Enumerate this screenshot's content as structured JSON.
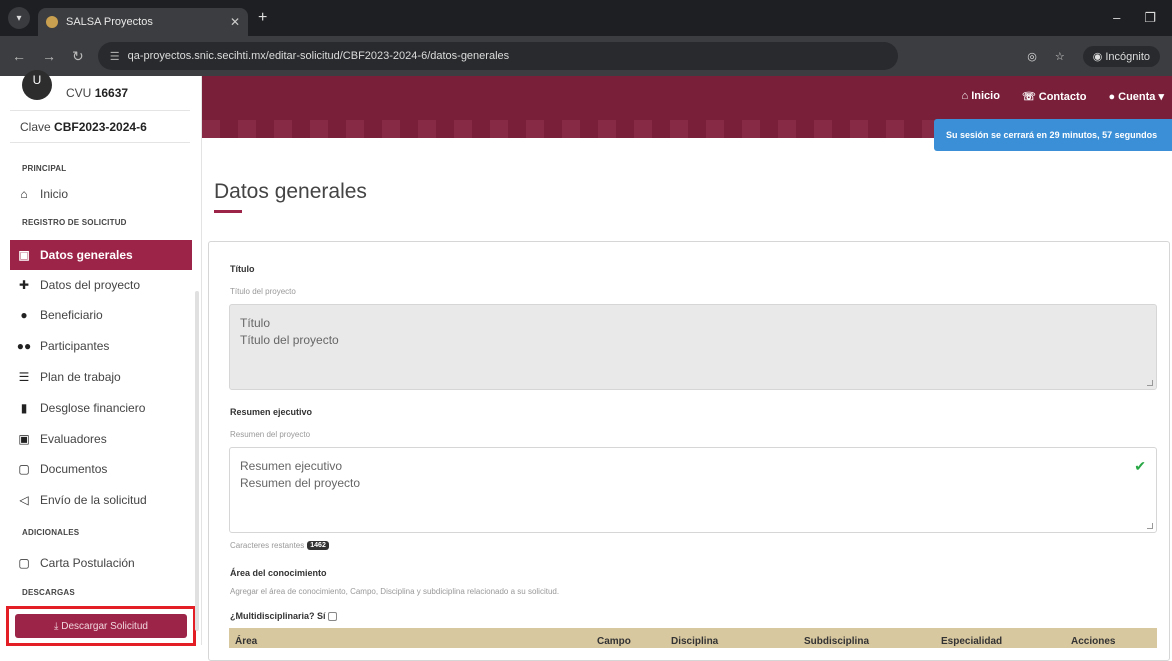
{
  "browser": {
    "tab_title": "SALSA Proyectos",
    "url": "qa-proyectos.snic.secihti.mx/editar-solicitud/CBF2023-2024-6/datos-generales",
    "incognito_label": "Incógnito"
  },
  "user": {
    "avatar_letter": "U",
    "cvu_label": "CVU",
    "cvu_value": "16637",
    "clave_label": "Clave",
    "clave_value": "CBF2023-2024-6"
  },
  "sidebar": {
    "section_principal": "PRINCIPAL",
    "section_registro": "REGISTRO DE SOLICITUD",
    "section_adicionales": "ADICIONALES",
    "section_descargas": "DESCARGAS",
    "items": [
      {
        "label": "Inicio",
        "icon": "home-icon"
      },
      {
        "label": "Datos generales",
        "icon": "document-icon"
      },
      {
        "label": "Datos del proyecto",
        "icon": "puzzle-icon"
      },
      {
        "label": "Beneficiario",
        "icon": "user-icon"
      },
      {
        "label": "Participantes",
        "icon": "users-icon"
      },
      {
        "label": "Plan de trabajo",
        "icon": "list-icon"
      },
      {
        "label": "Desglose financiero",
        "icon": "bar-chart-icon"
      },
      {
        "label": "Evaluadores",
        "icon": "evaluator-icon"
      },
      {
        "label": "Documentos",
        "icon": "file-icon"
      },
      {
        "label": "Envío de la solicitud",
        "icon": "send-icon"
      },
      {
        "label": "Carta Postulación",
        "icon": "file-icon"
      }
    ],
    "download_label": "Descargar Solicitud"
  },
  "header": {
    "nav_inicio": "Inicio",
    "nav_contacto": "Contacto",
    "nav_cuenta": "Cuenta",
    "session_notice": "Su sesión se cerrará en 29 minutos, 57 segundos"
  },
  "main": {
    "page_title": "Datos generales",
    "titulo_label": "Título",
    "titulo_hint": "Título del proyecto",
    "titulo_line1": "Título",
    "titulo_line2": "Título del proyecto",
    "resumen_label": "Resumen ejecutivo",
    "resumen_hint": "Resumen del proyecto",
    "resumen_line1": "Resumen ejecutivo",
    "resumen_line2": "Resumen del proyecto",
    "chars_label": "Caracteres restantes",
    "chars_count": "1462",
    "area_label": "Área del conocimiento",
    "area_hint": "Agregar el área de conocimiento, Campo, Disciplina y subdiciplina relacionado a su solicitud.",
    "multi_label": "¿Multidisciplinaria? Sí",
    "table_headers": [
      "Área",
      "Campo",
      "Disciplina",
      "Subdisciplina",
      "Especialidad",
      "Acciones"
    ]
  },
  "colors": {
    "brand": "#9d2449",
    "band": "#7a1f3a",
    "notice": "#3b8fd6",
    "highlight": "#e31e24"
  }
}
